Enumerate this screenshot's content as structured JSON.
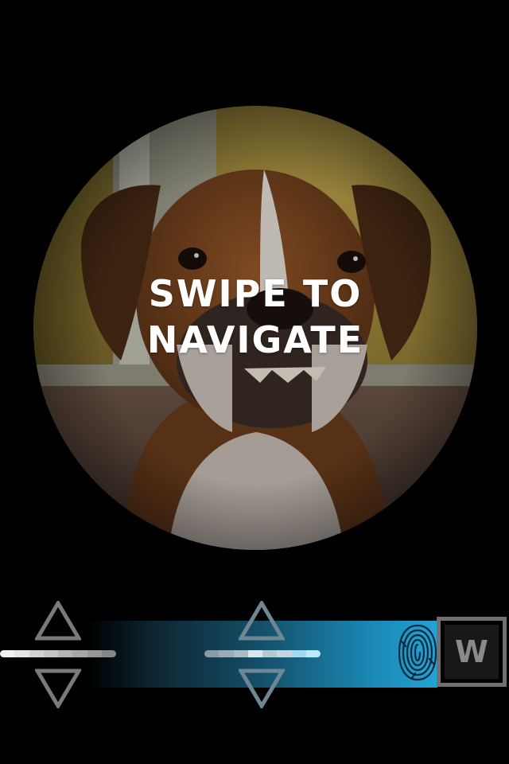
{
  "overlay": {
    "line1": "SWIPE TO",
    "line2": "NAVIGATE"
  },
  "photo": {
    "subject": "boxer dog portrait",
    "shape": "circle"
  },
  "navigator": {
    "logo_letter": "W",
    "band_colors": [
      "#0d2430",
      "#14506a",
      "#1a86b2",
      "#23a3d6"
    ],
    "accent": "#23a3d6",
    "icons": {
      "left_up": "triangle-up-icon",
      "left_down": "triangle-down-icon",
      "mid_up": "triangle-up-icon",
      "mid_down": "triangle-down-icon",
      "fingerprint": "fingerprint-icon",
      "logo": "w-logo"
    }
  }
}
